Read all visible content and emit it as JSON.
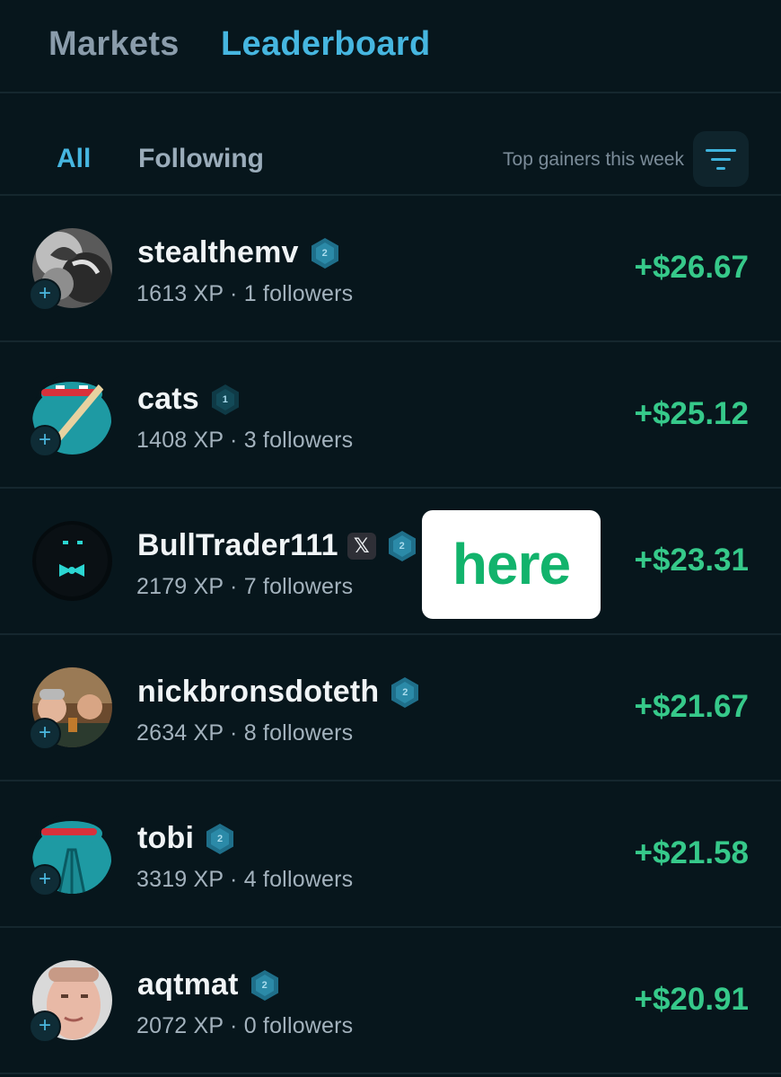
{
  "top_tabs": {
    "markets": "Markets",
    "leaderboard": "Leaderboard"
  },
  "sub_tabs": {
    "all": "All",
    "following": "Following"
  },
  "sort": {
    "label": "Top gainers this week"
  },
  "callout": {
    "text": "here"
  },
  "users": [
    {
      "name": "stealthemv",
      "level": "2",
      "xp": "1613 XP",
      "followers": "1 followers",
      "gain": "+$26.67",
      "x_linked": false
    },
    {
      "name": "cats",
      "level": "1",
      "xp": "1408 XP",
      "followers": "3 followers",
      "gain": "+$25.12",
      "x_linked": false
    },
    {
      "name": "BullTrader111",
      "level": "2",
      "xp": "2179 XP",
      "followers": "7 followers",
      "gain": "+$23.31",
      "x_linked": true,
      "x_label": "𝕏"
    },
    {
      "name": "nickbronsdoteth",
      "level": "2",
      "xp": "2634 XP",
      "followers": "8 followers",
      "gain": "+$21.67",
      "x_linked": false
    },
    {
      "name": "tobi",
      "level": "2",
      "xp": "3319 XP",
      "followers": "4 followers",
      "gain": "+$21.58",
      "x_linked": false
    },
    {
      "name": "aqtmat",
      "level": "2",
      "xp": "2072 XP",
      "followers": "0 followers",
      "gain": "+$20.91",
      "x_linked": false
    }
  ],
  "separator": " · ",
  "colors": {
    "accent": "#46b6e0",
    "gain": "#36c98a",
    "background": "#07161c"
  }
}
